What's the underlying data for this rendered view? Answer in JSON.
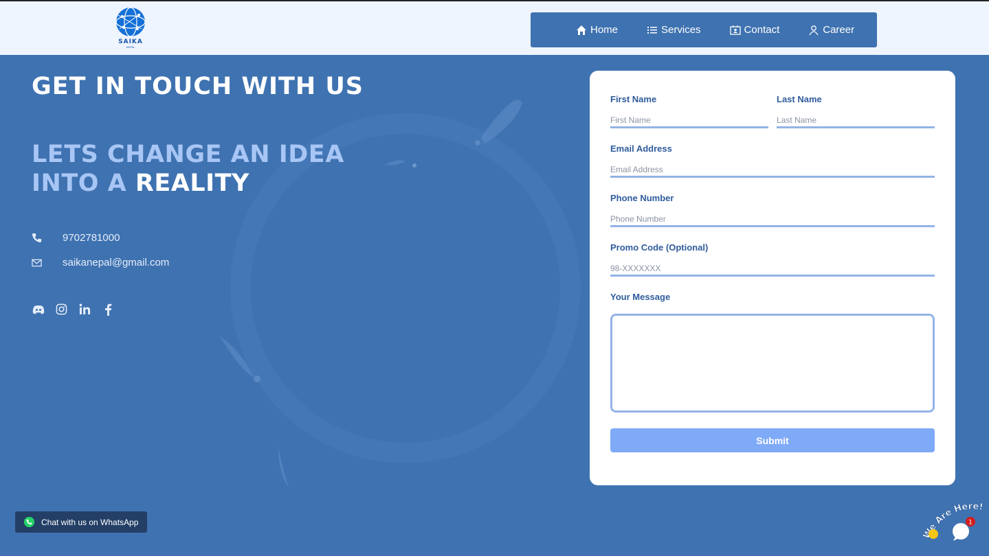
{
  "header": {
    "logo_text": "SAIKA",
    "logo_sub": "NEPAL",
    "nav": [
      {
        "label": "Home",
        "icon": "home-icon"
      },
      {
        "label": "Services",
        "icon": "list-icon"
      },
      {
        "label": "Contact",
        "icon": "contact-card-icon"
      },
      {
        "label": "Career",
        "icon": "user-icon"
      }
    ]
  },
  "hero": {
    "title": "GET IN TOUCH WITH US",
    "tagline_part1": "LETS CHANGE AN IDEA",
    "tagline_part2": "INTO A ",
    "tagline_highlight": "REALITY",
    "phone": "9702781000",
    "email": "saikanepal@gmail.com",
    "social": [
      "discord-icon",
      "instagram-icon",
      "linkedin-icon",
      "facebook-icon"
    ]
  },
  "form": {
    "first_name_label": "First Name",
    "first_name_placeholder": "First Name",
    "last_name_label": "Last Name",
    "last_name_placeholder": "Last Name",
    "email_label": "Email Address",
    "email_placeholder": "Email Address",
    "phone_label": "Phone Number",
    "phone_placeholder": "Phone Number",
    "promo_label": "Promo Code (Optional)",
    "promo_placeholder": "98-XXXXXXX",
    "message_label": "Your Message",
    "submit_label": "Submit"
  },
  "whatsapp": {
    "label": "Chat with us on WhatsApp"
  },
  "chat_widget": {
    "banner": "We Are Here!",
    "badge": "1"
  },
  "colors": {
    "background": "#3f72b0",
    "header": "#eef5ff",
    "accent": "#7faaf7",
    "input_border": "#93b3e6"
  }
}
